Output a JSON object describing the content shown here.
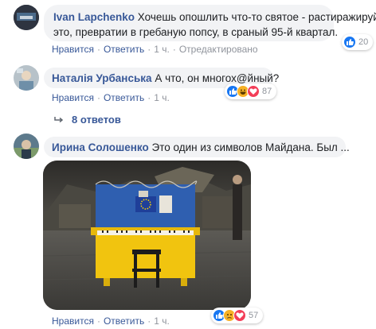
{
  "comments": [
    {
      "author": "Ivan Lapchenko",
      "text_line1": "Хочешь опошлить что-то святое - растиражируй",
      "text_line2": "это, превратии в гребаную попсу, в сраный 95-й квартал.",
      "actions": {
        "like": "Нравится",
        "reply": "Ответить",
        "time": "1 ч.",
        "edited": "Отредактировано"
      },
      "reactions": {
        "types": [
          "like"
        ],
        "count": "20"
      }
    },
    {
      "author": "Наталія Урбанська",
      "text": "А что, он многох@йный?",
      "actions": {
        "like": "Нравится",
        "reply": "Ответить",
        "time": "1 ч."
      },
      "reactions": {
        "types": [
          "like",
          "haha",
          "love"
        ],
        "count": "87"
      },
      "replies_label": "8 ответов"
    },
    {
      "author": "Ирина Солошенко",
      "text": "Это один из символов Майдана. Был ...",
      "actions": {
        "like": "Нравится",
        "reply": "Ответить",
        "time": "1 ч."
      },
      "reactions": {
        "types": [
          "like",
          "sad",
          "love"
        ],
        "count": "57"
      }
    }
  ],
  "colors": {
    "link": "#385898",
    "bubble": "#f2f3f5",
    "like": "#1877f2",
    "love": "#f33e58",
    "haha": "#f7b125",
    "piano_blue": "#2f5fb0",
    "piano_yellow": "#f1c40f"
  }
}
